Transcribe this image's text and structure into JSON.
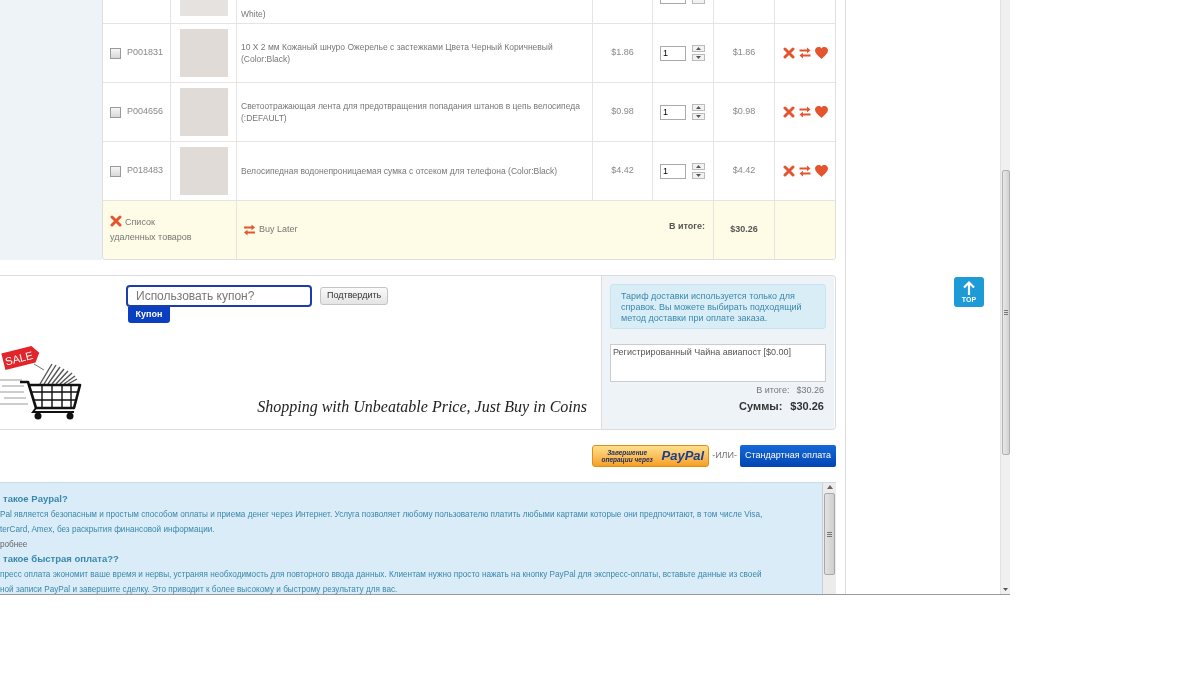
{
  "cart": {
    "rows": [
      {
        "kind": "partial",
        "description": "White)"
      },
      {
        "kind": "item",
        "checked": false,
        "code": "P001831",
        "description": "10 X 2 мм Кожаный шнуро Ожерелье с застежками Цвета Черный Коричневый (Color:Black)",
        "price": "$1.86",
        "quantity": "1",
        "total": "$1.86"
      },
      {
        "kind": "item",
        "checked": false,
        "code": "P004656",
        "description": "Светоотражающая лента для предотвращения попадания штанов в цепь велосипеда (:DEFAULT)",
        "price": "$0.98",
        "quantity": "1",
        "total": "$0.98"
      },
      {
        "kind": "item",
        "checked": false,
        "code": "P018483",
        "description": "Велосипедная водонепроницаемая сумка с отсеком для телефона (Color:Black)",
        "price": "$4.42",
        "quantity": "1",
        "total": "$4.42"
      }
    ],
    "footer": {
      "removed_label": "Список удаленных товаров",
      "buy_later_label": "Buy Later",
      "subtotal_label": "В итоге:",
      "subtotal_value": "$30.26"
    }
  },
  "coupon": {
    "placeholder": "Использовать купон?",
    "tab_label": "Купон",
    "apply_button": "Подтвердить"
  },
  "banner": {
    "sale_tag": "SALE",
    "slogan": "Shopping with Unbeatable Price, Just Buy in Coins"
  },
  "shipping": {
    "note": "Тариф доставки используется только для справок. Вы можете выбирать подходящий метод доставки при оплате заказа.",
    "method": "Регистрированный Чайна авиапост [$0.00]",
    "subtotal_label": "В итоге:",
    "subtotal_value": "$30.26",
    "total_label": "Суммы:",
    "total_value": "$30.26"
  },
  "checkout": {
    "paypal_caption": "Завершение операции через",
    "paypal_logo": "PayPal",
    "separator": "-ИЛИ-",
    "standard_button": "Стандартная оплата"
  },
  "faq": [
    {
      "kind": "question",
      "text": "такое Paypal?"
    },
    {
      "kind": "answer",
      "text": "Pal является безопасным и простым способом оплаты и приема денег через Интернет. Услуга позволяет любому пользователю платить любыми картами которые они предпочитают, в том числе Visa,"
    },
    {
      "kind": "answer",
      "text": "terCard, Amex, без раскрытия финансовой информации."
    },
    {
      "kind": "link",
      "text": "робнее"
    },
    {
      "kind": "question",
      "text": "такое быстрая оплата??"
    },
    {
      "kind": "answer",
      "text": "пресс оплата экономит ваше время и нервы, устраняя необходимость для повторного ввода данных. Клиентам нужно просто нажать на кнопку PayPal для экспресс-оплаты, вставьте данные из своей"
    },
    {
      "kind": "answer",
      "text": "ной записи PayPal и завершите сделку. Это приводит к более высокому и быстрому результату для вас."
    }
  ],
  "back_to_top": {
    "label": "TOP"
  }
}
